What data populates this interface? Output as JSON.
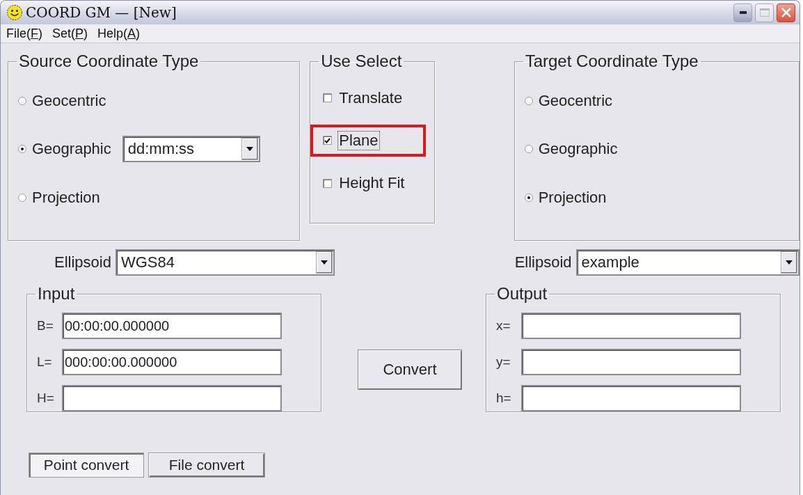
{
  "window": {
    "title": "COORD GM — [New]"
  },
  "menu": [
    {
      "label": "File(F)"
    },
    {
      "label": "Set(P)"
    },
    {
      "label": "Help(A)"
    }
  ],
  "source": {
    "title": "Source Coordinate Type",
    "options": [
      {
        "label": "Geocentric",
        "selected": false
      },
      {
        "label": "Geographic",
        "selected": true,
        "format": "dd:mm:ss"
      },
      {
        "label": "Projection",
        "selected": false
      }
    ]
  },
  "use_select": {
    "title": "Use Select",
    "options": [
      {
        "label": "Translate",
        "checked": false,
        "highlighted": false,
        "focused": false
      },
      {
        "label": "Plane",
        "checked": true,
        "highlighted": true,
        "focused": true
      },
      {
        "label": "Height Fit",
        "checked": false,
        "highlighted": false,
        "focused": false
      }
    ]
  },
  "target": {
    "title": "Target Coordinate Type",
    "options": [
      {
        "label": "Geocentric",
        "selected": false
      },
      {
        "label": "Geographic",
        "selected": false
      },
      {
        "label": "Projection",
        "selected": true
      }
    ]
  },
  "source_ellipsoid": {
    "label": "Ellipsoid",
    "value": "WGS84"
  },
  "target_ellipsoid": {
    "label": "Ellipsoid",
    "value": "example"
  },
  "input": {
    "title": "Input",
    "fields": [
      {
        "label": "B=",
        "value": "00:00:00.000000"
      },
      {
        "label": "L=",
        "value": "000:00:00.000000"
      },
      {
        "label": "H="
      }
    ]
  },
  "convert_button": "Convert",
  "output": {
    "title": "Output",
    "fields": [
      {
        "label": "x="
      },
      {
        "label": "y="
      },
      {
        "label": "h="
      }
    ]
  },
  "mode_tabs": [
    {
      "label": "Point convert",
      "selected": true
    },
    {
      "label": "File convert",
      "selected": false
    }
  ]
}
